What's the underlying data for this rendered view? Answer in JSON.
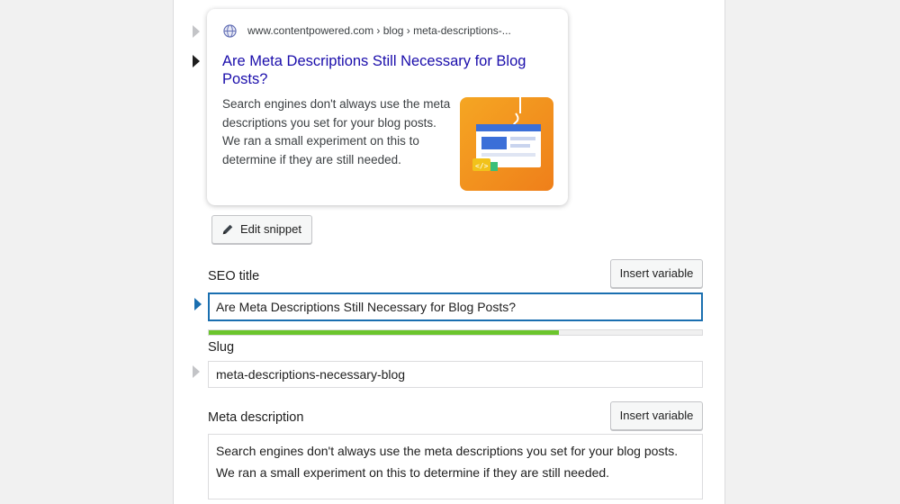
{
  "snippet_preview": {
    "breadcrumb": "www.contentpowered.com › blog › meta-descriptions-...",
    "title": "Are Meta Descriptions Still Necessary for Blog Posts?",
    "description": "Search engines don't always use the meta descriptions you set for your blog posts. We ran a small experiment on this to determine if they are still needed.",
    "edit_button_label": "Edit snippet"
  },
  "seo_title": {
    "label": "SEO title",
    "insert_variable_label": "Insert variable",
    "value": "Are Meta Descriptions Still Necessary for Blog Posts?",
    "progress_fraction": 0.71,
    "progress_color": "#6bc52c"
  },
  "slug": {
    "label": "Slug",
    "value": "meta-descriptions-necessary-blog"
  },
  "meta_description": {
    "label": "Meta description",
    "insert_variable_label": "Insert variable",
    "value": "Search engines don't always use the meta descriptions you set for your blog posts. We ran a small experiment on this to determine if they are still needed."
  },
  "colors": {
    "link_blue": "#1a0dab",
    "focus_blue": "#1a6fb0",
    "thumbnail_orange": "#f39422"
  }
}
